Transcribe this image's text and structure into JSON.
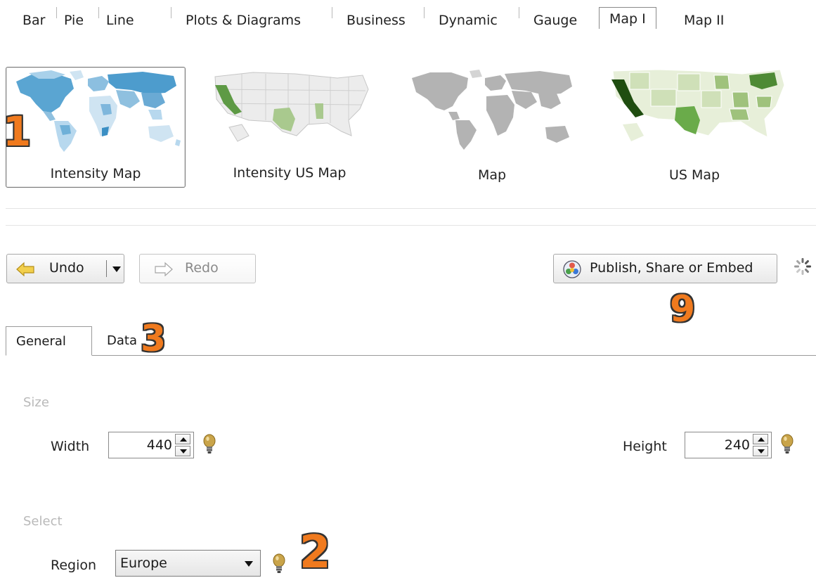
{
  "category_tabs": [
    "Bar",
    "Pie",
    "Line",
    "Plots & Diagrams",
    "Business",
    "Dynamic",
    "Gauge",
    "Map I",
    "Map II"
  ],
  "active_category": "Map I",
  "maps": [
    {
      "label": "Intensity Map",
      "selected": true
    },
    {
      "label": "Intensity US Map",
      "selected": false
    },
    {
      "label": "Map",
      "selected": false
    },
    {
      "label": "US Map",
      "selected": false
    }
  ],
  "toolbar": {
    "undo_label": "Undo",
    "redo_label": "Redo",
    "publish_label": "Publish, Share or Embed"
  },
  "form_tabs": [
    "General",
    "Data"
  ],
  "active_form_tab": "General",
  "size_section": {
    "label": "Size",
    "width_label": "Width",
    "width_value": "440",
    "height_label": "Height",
    "height_value": "240"
  },
  "select_section": {
    "label": "Select",
    "region_label": "Region",
    "region_value": "Europe"
  },
  "callouts": {
    "c1": "1",
    "c2": "2",
    "c3": "3",
    "c9": "9"
  },
  "colors": {
    "callout_orange": "#f07a1e",
    "intensity_blue": "#5aa5d2",
    "us_green_dark": "#1f4d10",
    "us_green_mid": "#6aab4a",
    "world_gray": "#b3b3b3"
  }
}
